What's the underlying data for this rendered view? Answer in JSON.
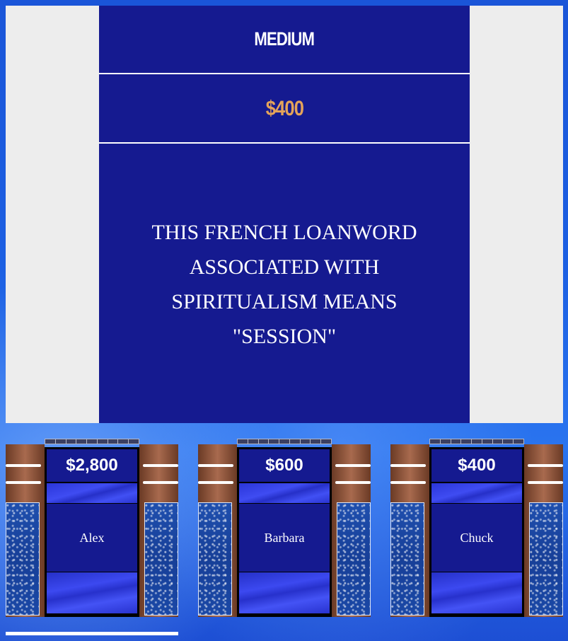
{
  "clue": {
    "category": "MEDIUM",
    "value": "$400",
    "question": "This French loanword associated with Spiritualism means \"session\""
  },
  "colors": {
    "card_blue": "#151a90",
    "value_gold": "#e4a35a",
    "panel_gray": "#ededed"
  },
  "players": [
    {
      "name": "Alex",
      "score": "$2,800"
    },
    {
      "name": "Barbara",
      "score": "$600"
    },
    {
      "name": "Chuck",
      "score": "$400"
    }
  ]
}
